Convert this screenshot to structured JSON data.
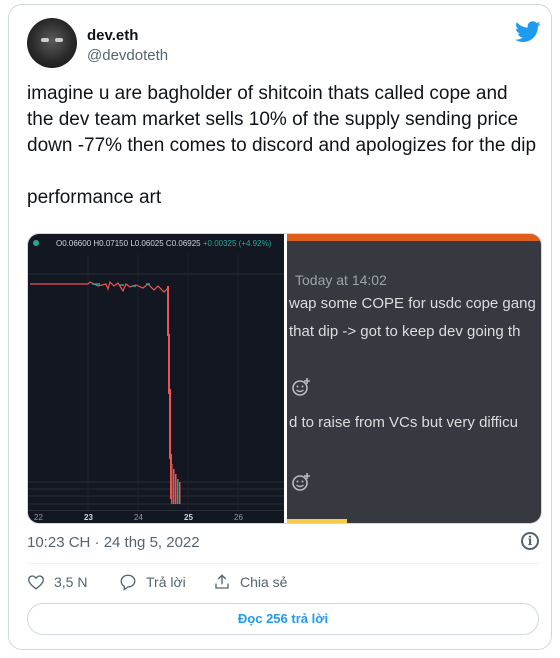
{
  "author": {
    "name": "dev.eth",
    "handle": "@devdoteth"
  },
  "tweet": {
    "text": "imagine u are bagholder of shitcoin thats called cope and the dev team market sells 10% of the supply sending price down -77% then comes to discord and apologizes for the dip\n\nperformance art",
    "timestamp": "10:23 CH · 24 thg 5, 2022"
  },
  "media": {
    "chart": {
      "ohlc_o": "O0.06600",
      "ohlc_h": "H0.07150",
      "ohlc_l": "L0.06025",
      "ohlc_c": "C0.06925",
      "ohlc_change": "+0.00325 (+4.92%)",
      "x_ticks": [
        "22",
        "23",
        "24",
        "25",
        "26"
      ]
    },
    "discord": {
      "time": "Today at 14:02",
      "line1": "wap some COPE for usdc cope gang",
      "line2": "that dip -> got to keep dev going th",
      "line3": "d to raise from VCs but very difficu"
    }
  },
  "actions": {
    "likes": "3,5 N",
    "reply": "Trả lời",
    "share": "Chia sẻ"
  },
  "read_replies": "Đọc 256 trả lời",
  "colors": {
    "accent": "#1d9bf0",
    "chart_bg": "#131722",
    "discord_bg": "#36393f",
    "down_red": "#ef5350",
    "up_green": "#26a69a"
  }
}
